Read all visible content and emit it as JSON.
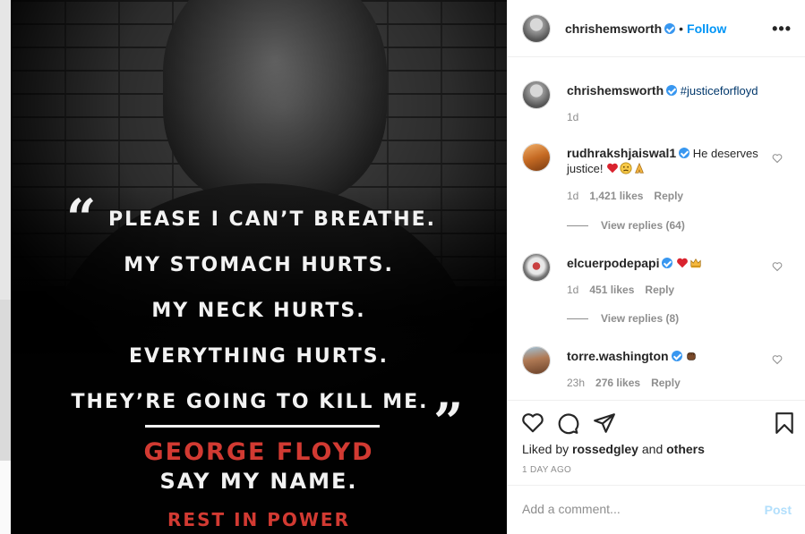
{
  "post": {
    "quote_lines": [
      "PLEASE I CAN’T BREATHE.",
      "MY STOMACH HURTS.",
      "MY NECK HURTS.",
      "EVERYTHING HURTS.",
      "THEY’RE GOING TO KILL ME."
    ],
    "name_line": "GEORGE FLOYD",
    "say_line": "SAY MY NAME.",
    "rest_line": "REST IN POWER"
  },
  "header": {
    "username": "chrishemsworth",
    "separator": "•",
    "follow_label": "Follow",
    "more_label": "•••"
  },
  "caption": {
    "username": "chrishemsworth",
    "text": "#justiceforfloyd",
    "time": "1d"
  },
  "comments": [
    {
      "username": "rudhrakshjaiswal1",
      "text": "He deserves justice!",
      "emojis": [
        "red-heart",
        "sad-face",
        "praying-hands"
      ],
      "time": "1d",
      "likes": "1,421 likes",
      "reply_label": "Reply",
      "view_replies": "View replies (64)"
    },
    {
      "username": "elcuerpodepapi",
      "text": "",
      "emojis": [
        "red-heart",
        "crown"
      ],
      "time": "1d",
      "likes": "451 likes",
      "reply_label": "Reply",
      "view_replies": "View replies (8)"
    },
    {
      "username": "torre.washington",
      "text": "",
      "emojis": [
        "raised-fist"
      ],
      "time": "23h",
      "likes": "276 likes",
      "reply_label": "Reply"
    }
  ],
  "actions": {
    "liked_by_prefix": "Liked by",
    "liked_by_user": "rossedgley",
    "liked_by_and": "and",
    "liked_by_others": "others",
    "time_ago": "1 DAY AGO"
  },
  "comment_box": {
    "placeholder": "Add a comment...",
    "post_label": "Post"
  },
  "colors": {
    "accent": "#0095f6",
    "verified": "#3897f0",
    "poster_red": "#d23a32"
  }
}
